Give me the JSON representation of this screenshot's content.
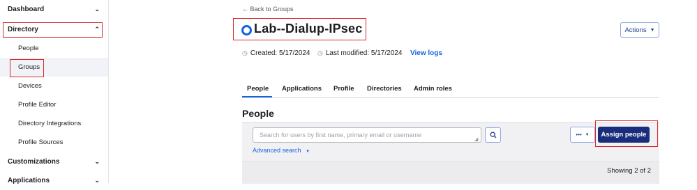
{
  "sidebar": {
    "dashboard": "Dashboard",
    "directory": "Directory",
    "items": [
      {
        "label": "People"
      },
      {
        "label": "Groups"
      },
      {
        "label": "Devices"
      },
      {
        "label": "Profile Editor"
      },
      {
        "label": "Directory Integrations"
      },
      {
        "label": "Profile Sources"
      }
    ],
    "customizations": "Customizations",
    "applications": "Applications"
  },
  "header": {
    "back": "← Back to Groups",
    "title": "Lab--Dialup-IPsec",
    "actions": "Actions",
    "created": "Created: 5/17/2024",
    "modified": "Last modified: 5/17/2024",
    "view_logs": "View logs"
  },
  "tabs": [
    "People",
    "Applications",
    "Profile",
    "Directories",
    "Admin roles"
  ],
  "people": {
    "heading": "People",
    "search_placeholder": "Search for users by first name, primary email or username",
    "advanced_search": "Advanced search",
    "more": "•••",
    "assign": "Assign people",
    "showing": "Showing 2 of 2"
  },
  "colors": {
    "accent": "#1662dd",
    "primary_button": "#1a2d7c",
    "highlight": "#d9282f"
  }
}
